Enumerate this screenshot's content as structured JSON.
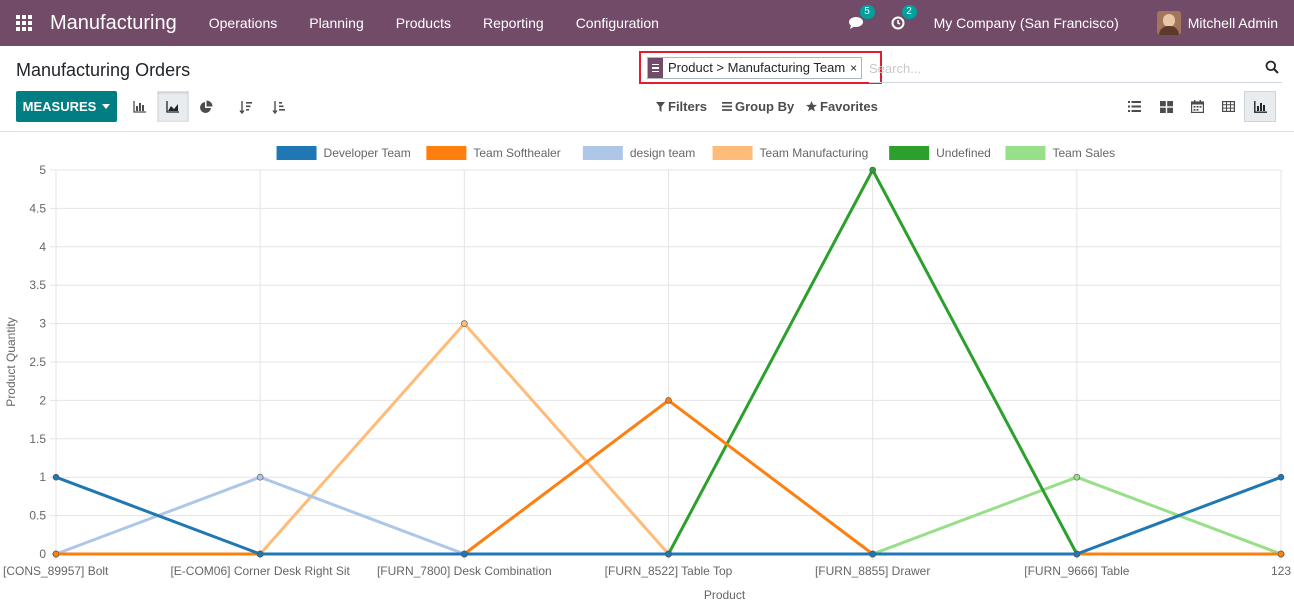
{
  "navbar": {
    "brand": "Manufacturing",
    "menu": [
      "Operations",
      "Planning",
      "Products",
      "Reporting",
      "Configuration"
    ],
    "messages_count": "5",
    "activities_count": "2",
    "company": "My Company (San Francisco)",
    "user": "Mitchell Admin",
    "bg_color": "#714B67"
  },
  "control_panel": {
    "title": "Manufacturing Orders",
    "facet": {
      "label": "Product > Manufacturing Team",
      "remove": "×"
    },
    "search_placeholder": "Search...",
    "measures_label": "MEASURES",
    "filters_label": "Filters",
    "groupby_label": "Group By",
    "favorites_label": "Favorites",
    "chart_modes": [
      "bar-chart-icon",
      "line-chart-icon",
      "pie-chart-icon"
    ],
    "active_chart_mode": "line-chart-icon",
    "sort_buttons": [
      "sort-descending-icon",
      "sort-ascending-icon"
    ],
    "views": [
      "list-view-icon",
      "kanban-view-icon",
      "calendar-view-icon",
      "pivot-view-icon",
      "graph-view-icon"
    ],
    "active_view": "graph-view-icon",
    "accent_color": "#017e84"
  },
  "chart_data": {
    "type": "line",
    "xlabel": "Product",
    "ylabel": "Product Quantity",
    "ylim": [
      0,
      5
    ],
    "yticks": [
      "0",
      "0.5",
      "1",
      "1.5",
      "2",
      "2.5",
      "3",
      "3.5",
      "4",
      "4.5",
      "5"
    ],
    "categories": [
      "[CONS_89957] Bolt",
      "[E-COM06] Corner Desk Right Sit",
      "[FURN_7800] Desk Combination",
      "[FURN_8522] Table Top",
      "[FURN_8855] Drawer",
      "[FURN_9666] Table",
      "123"
    ],
    "grid": true,
    "legend_position": "top",
    "series": [
      {
        "name": "Developer Team",
        "color": "#1f77b4",
        "values": [
          1,
          0,
          0,
          0,
          0,
          0,
          1
        ]
      },
      {
        "name": "Team Softhealer",
        "color": "#ff7f0e",
        "values": [
          0,
          0,
          0,
          2,
          0,
          0,
          0
        ]
      },
      {
        "name": "design team",
        "color": "#aec7e8",
        "values": [
          0,
          1,
          0,
          0,
          0,
          0,
          0
        ]
      },
      {
        "name": "Team Manufacturing",
        "color": "#ffbb78",
        "values": [
          0,
          0,
          3,
          0,
          0,
          0,
          0
        ]
      },
      {
        "name": "Undefined",
        "color": "#2ca02c",
        "values": [
          0,
          0,
          0,
          0,
          5,
          0,
          0
        ]
      },
      {
        "name": "Team Sales",
        "color": "#98df8a",
        "values": [
          0,
          0,
          0,
          0,
          0,
          1,
          0
        ]
      }
    ]
  }
}
